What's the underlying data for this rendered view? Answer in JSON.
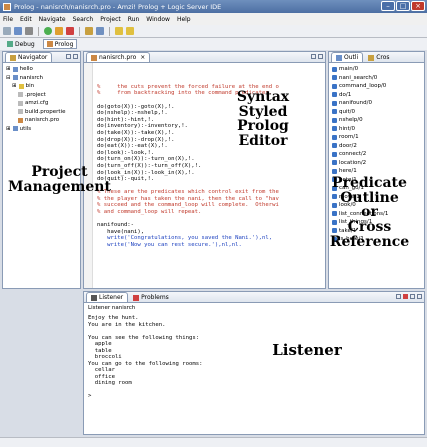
{
  "window": {
    "title": "Prolog - nanisrch/nanisrch.pro - Amzi! Prolog + Logic Server IDE"
  },
  "menu": [
    "File",
    "Edit",
    "Navigate",
    "Search",
    "Project",
    "Run",
    "Window",
    "Help"
  ],
  "perspectives": [
    {
      "label": "Debug"
    },
    {
      "label": "Prolog"
    }
  ],
  "navigator": {
    "tab": "Navigator",
    "items": [
      "hello",
      "nanisrch",
      "bin",
      ".project",
      "amzi.cfg",
      "build.propertie",
      "nanisrch.pro",
      "utils"
    ]
  },
  "editor": {
    "tab": "nanisrch.pro",
    "lines": [
      {
        "t": "%     the cuts prevent the forced failure at the end o",
        "c": "cmt"
      },
      {
        "t": "%     from backtracking into the command predicates.",
        "c": "cmt"
      },
      {
        "t": "",
        "c": "pred"
      },
      {
        "t": "do(goto(X)):-goto(X),!.",
        "c": "pred"
      },
      {
        "t": "do(nshelp):-nshelp,!.",
        "c": "pred"
      },
      {
        "t": "do(hint):-hint,!.",
        "c": "pred"
      },
      {
        "t": "do(inventory):-inventory,!.",
        "c": "pred"
      },
      {
        "t": "do(take(X)):-take(X),!.",
        "c": "pred"
      },
      {
        "t": "do(drop(X)):-drop(X),!.",
        "c": "pred"
      },
      {
        "t": "do(eat(X)):-eat(X),!.",
        "c": "pred"
      },
      {
        "t": "do(look):-look,!.",
        "c": "pred"
      },
      {
        "t": "do(turn_on(X)):-turn_on(X),!.",
        "c": "pred"
      },
      {
        "t": "do(turn_off(X)):-turn_off(X),!.",
        "c": "pred"
      },
      {
        "t": "do(look_in(X)):-look_in(X),!.",
        "c": "pred"
      },
      {
        "t": "do(quit):-quit,!.",
        "c": "pred"
      },
      {
        "t": "",
        "c": "pred"
      },
      {
        "t": "% These are the predicates which control exit from the",
        "c": "cmt"
      },
      {
        "t": "% the player has taken the nani, then the call to \"hav",
        "c": "cmt"
      },
      {
        "t": "% succeed and the command_loop will complete.  Otherwi",
        "c": "cmt"
      },
      {
        "t": "% and command_loop will repeat.",
        "c": "cmt"
      },
      {
        "t": "",
        "c": "pred"
      },
      {
        "t": "nanifound:-",
        "c": "pred"
      },
      {
        "t": "   have(nani),",
        "c": "pred"
      },
      {
        "t": "   write('Congratulations, you saved the Nani.'),nl,",
        "c": "str"
      },
      {
        "t": "   write('Now you can rest secure.'),nl,nl.",
        "c": "str"
      }
    ]
  },
  "outline": {
    "tabs": [
      "Outli",
      "Cros"
    ],
    "items": [
      "main/0",
      "nani_search/0",
      "command_loop/0",
      "do/1",
      "nanifound/0",
      "quit/0",
      "nshelp/0",
      "hint/0",
      "room/1",
      "door/2",
      "connect/2",
      "location/2",
      "here/1",
      "goto/1",
      "can_go/1",
      "move/1",
      "look/0",
      "list_connections/1",
      "list_things/1",
      "take/1",
      "is_here/1"
    ]
  },
  "listener": {
    "tabs": [
      "Listener",
      "Problems"
    ],
    "header": "Listener nanisrch",
    "lines": [
      "Enjoy the hunt.",
      "You are in the kitchen.",
      "",
      "You can see the following things:",
      "  apple",
      "  table",
      "  broccoli",
      "You can go to the following rooms:",
      "  cellar",
      "  office",
      "  dining room",
      "",
      ">"
    ]
  },
  "annotations": {
    "syntax": "Syntax\nStyled\nProlog\nEditor",
    "project": "Project\nManagement",
    "outline": "Predicate\nOutline\nor\nCross\nReference",
    "listener": "Listener"
  }
}
